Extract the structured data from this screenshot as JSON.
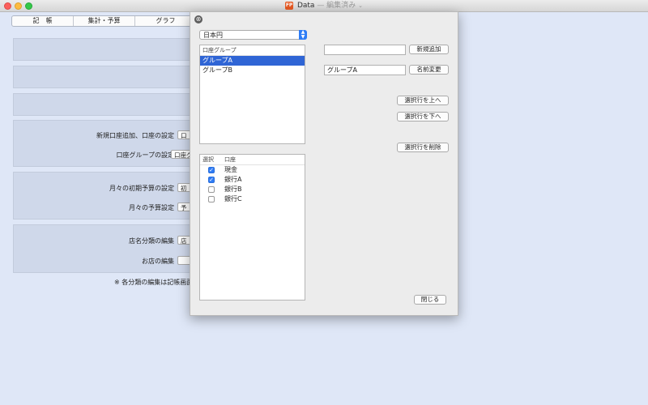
{
  "window": {
    "app_icon": "FP",
    "title": "Data",
    "state": "— 編集済み",
    "chevron": "⌄"
  },
  "tabs": [
    "記　帳",
    "集計・予算",
    "グラフ"
  ],
  "background": {
    "rows": [
      {
        "label": "新規口座追加、口座の設定",
        "button": "口"
      },
      {
        "label": "口座グループの設定",
        "button": "口座グ"
      },
      {
        "label": "月々の初期予算の設定",
        "button": "初"
      },
      {
        "label": "月々の予算設定",
        "button": "予"
      },
      {
        "label": "店名分類の編集",
        "button": "店"
      },
      {
        "label": "お店の編集",
        "button": ""
      }
    ],
    "note": "※ 各分類の編集は記帳画面"
  },
  "sheet": {
    "close_icon": "⊗",
    "currency": "日本円",
    "group_list": {
      "header": "口座グループ",
      "items": [
        "グループA",
        "グループB"
      ],
      "selected_index": 0
    },
    "accounts_list": {
      "col_select": "選択",
      "col_account": "口座",
      "items": [
        {
          "name": "現金",
          "checked": true
        },
        {
          "name": "銀行A",
          "checked": true
        },
        {
          "name": "銀行B",
          "checked": false
        },
        {
          "name": "銀行C",
          "checked": false
        }
      ]
    },
    "new_group_value": "",
    "rename_value": "グループA",
    "buttons": {
      "add_new": "新規追加",
      "rename": "名前変更",
      "move_up": "選択行を上へ",
      "move_down": "選択行を下へ",
      "delete": "選択行を削除",
      "close": "閉じる"
    }
  },
  "colors": {
    "selection": "#2f65d5",
    "checkbox": "#2f7cf6",
    "background": "#dfe7f7"
  }
}
